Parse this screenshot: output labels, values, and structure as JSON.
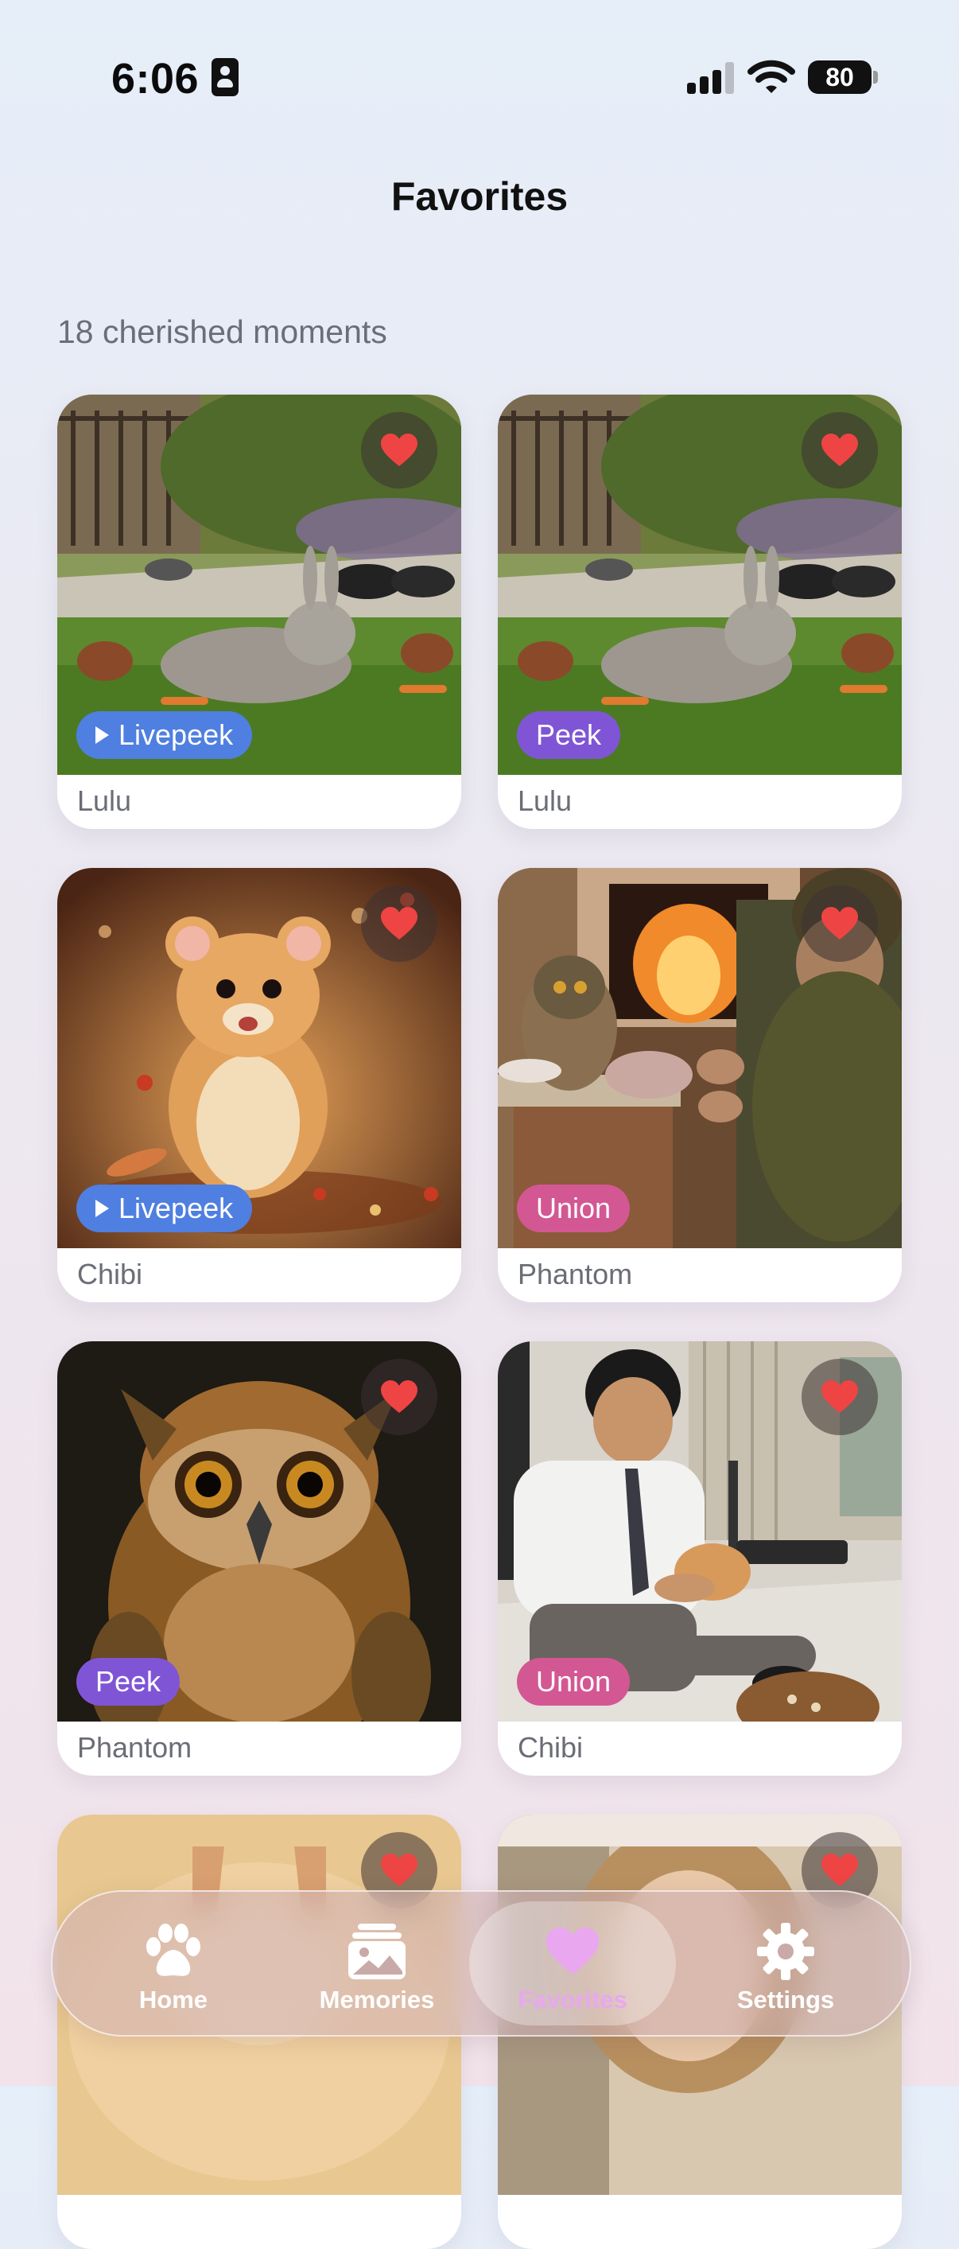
{
  "status_bar": {
    "time": "6:06",
    "battery": "80"
  },
  "header": {
    "title": "Favorites",
    "subtitle": "18 cherished moments"
  },
  "cards": [
    {
      "name": "Lulu",
      "badge": "Livepeek",
      "badge_type": "livepeek",
      "favorited": true
    },
    {
      "name": "Lulu",
      "badge": "Peek",
      "badge_type": "peek",
      "favorited": true
    },
    {
      "name": "Chibi",
      "badge": "Livepeek",
      "badge_type": "livepeek",
      "favorited": true
    },
    {
      "name": "Phantom",
      "badge": "Union",
      "badge_type": "union",
      "favorited": true
    },
    {
      "name": "Phantom",
      "badge": "Peek",
      "badge_type": "peek",
      "favorited": true
    },
    {
      "name": "Chibi",
      "badge": "Union",
      "badge_type": "union",
      "favorited": true
    }
  ],
  "tab_bar": {
    "items": [
      {
        "label": "Home",
        "icon": "paw-icon"
      },
      {
        "label": "Memories",
        "icon": "photo-stack-icon"
      },
      {
        "label": "Favorites",
        "icon": "heart-icon",
        "active": true
      },
      {
        "label": "Settings",
        "icon": "gear-icon"
      }
    ]
  },
  "colors": {
    "heart": "#ef4444",
    "livepeek_badge": "#4f7fe0",
    "peek_badge": "#7f55d6",
    "union_badge": "#d35793",
    "active_tab": "#e9a7f0"
  }
}
